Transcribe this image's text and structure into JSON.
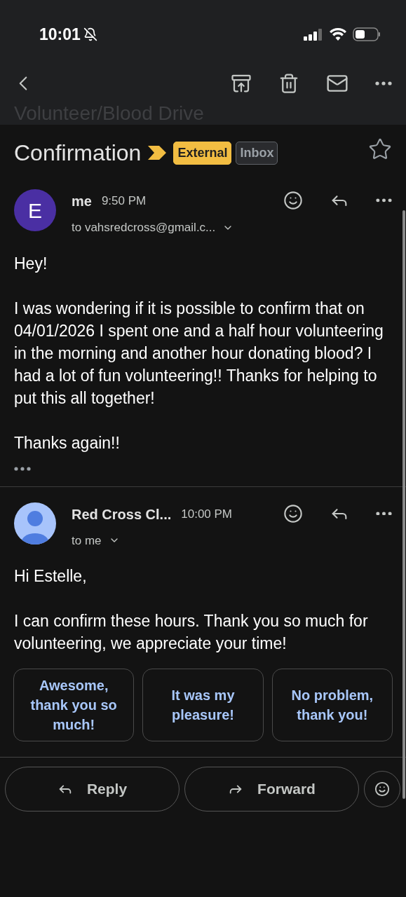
{
  "status_bar": {
    "time": "10:01",
    "silent": true
  },
  "toolbar": {
    "faded_subject": "Volunteer/Blood Drive"
  },
  "subject": {
    "title": "Confirmation",
    "important": true,
    "labels": [
      {
        "text": "External",
        "kind": "external"
      },
      {
        "text": "Inbox",
        "kind": "inbox"
      }
    ],
    "starred": false
  },
  "messages": [
    {
      "avatar": {
        "kind": "letter",
        "letter": "E"
      },
      "sender": "me",
      "time": "9:50 PM",
      "recipient": "to vahsredcross@gmail.c...",
      "paragraphs": [
        "Hey!",
        "I was wondering if it is possible to confirm that on 04/01/2026 I spent one and a half hour volunteering in the morning and another hour donating blood? I had a lot of fun volunteering!! Thanks for helping to put this all together!",
        "Thanks again!!"
      ],
      "trimmed": true
    },
    {
      "avatar": {
        "kind": "person"
      },
      "sender": "Red Cross Cl...",
      "time": "10:00 PM",
      "recipient": "to me",
      "paragraphs": [
        "Hi Estelle,",
        "I can confirm these hours. Thank you so much for volunteering, we appreciate your time!"
      ]
    }
  ],
  "smart_replies": [
    "Awesome, thank you so much!",
    "It was my pleasure!",
    "No problem, thank you!"
  ],
  "actions": [
    {
      "label": "Reply",
      "kind": "reply"
    },
    {
      "label": "Forward",
      "kind": "forward"
    }
  ]
}
